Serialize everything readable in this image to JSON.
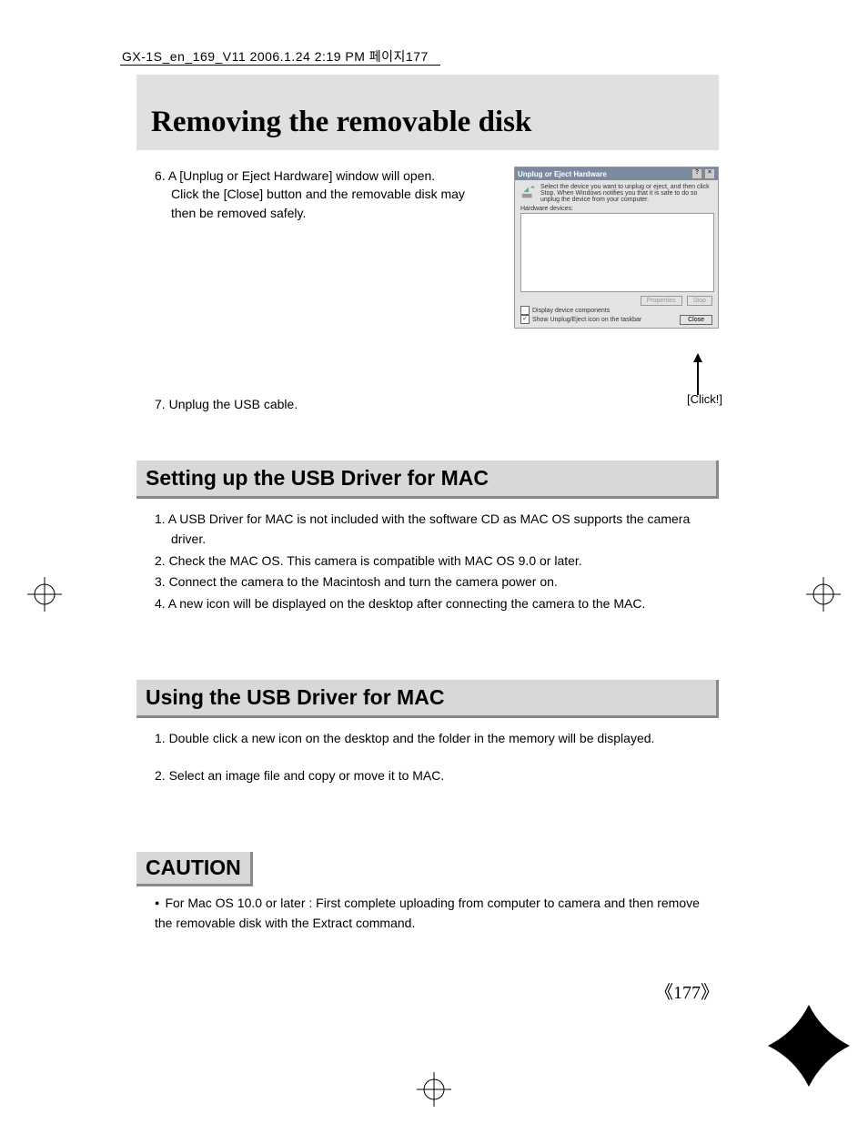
{
  "header": "GX-1S_en_169_V11  2006.1.24 2:19 PM  페이지177",
  "title": "Removing the removable disk",
  "step6": {
    "num": "6.",
    "line1": "A [Unplug or Eject Hardware] window will open.",
    "line2": "Click the [Close] button and the removable disk may",
    "line3": "then be removed safely."
  },
  "step7": {
    "num": "7.",
    "text": "Unplug the USB cable."
  },
  "dialog": {
    "title": "Unplug or Eject Hardware",
    "btnHelp": "?",
    "btnClose": "×",
    "msg": "Select the device you want to unplug or eject, and then click Stop. When Windows notifies you that it is safe to do so unplug the device from your computer.",
    "hwLabel": "Hardware devices:",
    "btnProperties": "Properties",
    "btnStop": "Stop",
    "chk1": "Display device components",
    "chk2": "Show Unplug/Eject icon on the taskbar",
    "closeBtn": "Close",
    "check2Mark": "✓"
  },
  "clickLabel": "[Click!]",
  "section1": {
    "heading": "Setting up the USB Driver for MAC",
    "items": [
      "1. A USB Driver for MAC is not included with the software CD as MAC OS supports the camera driver.",
      "2. Check the MAC OS. This camera is compatible with MAC OS 9.0 or later.",
      "3. Connect the camera to the Macintosh and turn the camera power on.",
      "4. A new icon will be displayed on the desktop after connecting the camera to the MAC."
    ]
  },
  "section2": {
    "heading": "Using the USB Driver for MAC",
    "items": [
      "1. Double click a new icon on the desktop and the folder in the memory will be displayed.",
      "2. Select an image file and copy or move it to MAC."
    ]
  },
  "caution": {
    "heading": "CAUTION",
    "text": "For Mac OS 10.0 or later : First complete uploading from computer to camera and then remove the removable disk with the Extract command."
  },
  "pageNum": "《177》"
}
